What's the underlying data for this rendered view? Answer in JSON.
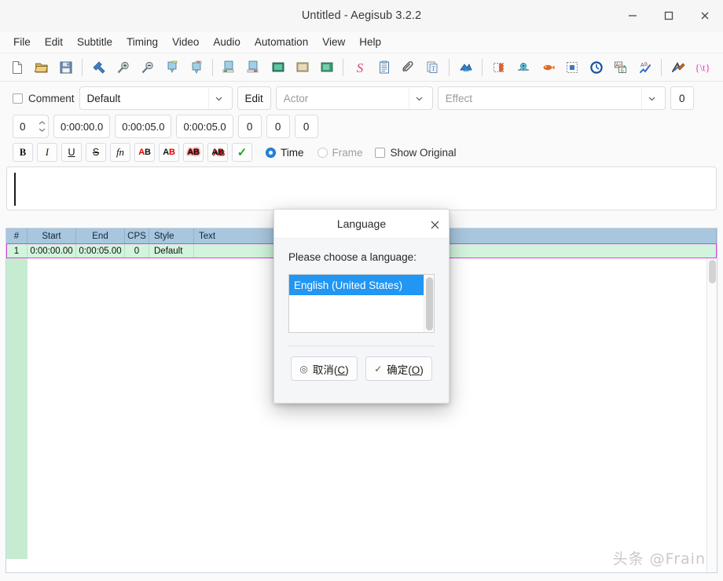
{
  "window": {
    "title": "Untitled - Aegisub 3.2.2",
    "controls": [
      {
        "name": "minimize",
        "glyph": "minimize-icon"
      },
      {
        "name": "maximize",
        "glyph": "maximize-icon"
      },
      {
        "name": "close",
        "glyph": "close-icon"
      }
    ]
  },
  "menubar": {
    "items": [
      {
        "label": "File"
      },
      {
        "label": "Edit"
      },
      {
        "label": "Subtitle"
      },
      {
        "label": "Timing"
      },
      {
        "label": "Video"
      },
      {
        "label": "Audio"
      },
      {
        "label": "Automation"
      },
      {
        "label": "View"
      },
      {
        "label": "Help"
      }
    ]
  },
  "toolbar": {
    "groups": [
      [
        "new-subtitles-icon",
        "open-subtitles-icon",
        "save-subtitles-icon"
      ],
      [
        "jump-to-icon",
        "zoom-in-icon",
        "zoom-out-icon",
        "play-video-icon",
        "play-line-icon"
      ],
      [
        "snap-start-to-video-icon",
        "snap-end-to-video-icon",
        "shift-to-frame-icon",
        "snap-video-to-start-icon",
        "snap-video-to-end-icon"
      ],
      [
        "styles-manager-icon",
        "properties-icon",
        "attachments-icon",
        "fonts-collector-icon"
      ],
      [
        "resample-icon"
      ],
      [
        "cycle-active-icon",
        "select-visible-icon",
        "select-lines-icon",
        "shift-times-icon",
        "timing-postprocessor-icon",
        "translation-assistant-icon",
        "styling-assistant-icon"
      ],
      [
        "kanji-timer-icon",
        "tags-icon"
      ]
    ]
  },
  "edit_area": {
    "comment_label": "Comment",
    "comment_checked": false,
    "style_value": "Default",
    "edit_button": "Edit",
    "actor_placeholder": "Actor",
    "actor_value": "",
    "effect_placeholder": "Effect",
    "effect_value": "",
    "layer_right_value": "0",
    "spin_value": "0",
    "start_time": "0:00:00.0",
    "end_time": "0:00:05.0",
    "duration": "0:00:05.0",
    "margin_l": "0",
    "margin_r": "0",
    "margin_v": "0",
    "format_buttons": [
      {
        "name": "bold-button",
        "label": "B",
        "style": "b"
      },
      {
        "name": "italic-button",
        "label": "I",
        "style": "i"
      },
      {
        "name": "underline-button",
        "label": "U",
        "style": "u"
      },
      {
        "name": "strikeout-button",
        "label": "S",
        "style": "s"
      },
      {
        "name": "font-select-button",
        "label": "fn",
        "style": "fn"
      }
    ],
    "color_buttons": [
      {
        "name": "primary-color-button",
        "a": "A",
        "b": "B",
        "a_color": "#e00000",
        "b_color": "#111111"
      },
      {
        "name": "secondary-color-button",
        "a": "A",
        "b": "B",
        "a_color": "#111111",
        "b_color": "#e00000"
      },
      {
        "name": "outline-color-button",
        "a": "A",
        "b": "B",
        "a_color": "#111111",
        "b_color": "#111111"
      },
      {
        "name": "shadow-color-button",
        "a": "A",
        "b": "B",
        "a_color": "#111111",
        "b_color": "#111111"
      }
    ],
    "commit_label": "✓",
    "time_radio_label": "Time",
    "time_radio_selected": true,
    "frame_radio_label": "Frame",
    "frame_radio_selected": false,
    "show_original_label": "Show Original",
    "show_original_checked": false,
    "text_value": ""
  },
  "grid": {
    "columns": [
      {
        "key": "num",
        "label": "#"
      },
      {
        "key": "start",
        "label": "Start"
      },
      {
        "key": "end",
        "label": "End"
      },
      {
        "key": "cps",
        "label": "CPS"
      },
      {
        "key": "style",
        "label": "Style"
      },
      {
        "key": "text",
        "label": "Text"
      }
    ],
    "rows": [
      {
        "num": "1",
        "start": "0:00:00.00",
        "end": "0:00:05.00",
        "cps": "0",
        "style": "Default",
        "text": ""
      }
    ],
    "header_bg": "#a8c6de",
    "row_bg": "#d2f4dd",
    "selection_outline": "#e040e0"
  },
  "dialog": {
    "title": "Language",
    "close_icon": "close-icon",
    "prompt": "Please choose a language:",
    "list": {
      "options": [
        "English (United States)"
      ],
      "selected_index": 0,
      "selected_color": "#2196f3"
    },
    "buttons": [
      {
        "name": "cancel-button",
        "glyph": "cancel-icon",
        "text_pre": "取消(",
        "key": "C",
        "text_post": ")"
      },
      {
        "name": "ok-button",
        "glyph": "check-icon",
        "text_pre": "确定(",
        "key": "O",
        "text_post": ")"
      }
    ]
  },
  "watermark": {
    "text": "头条 @Frain"
  }
}
